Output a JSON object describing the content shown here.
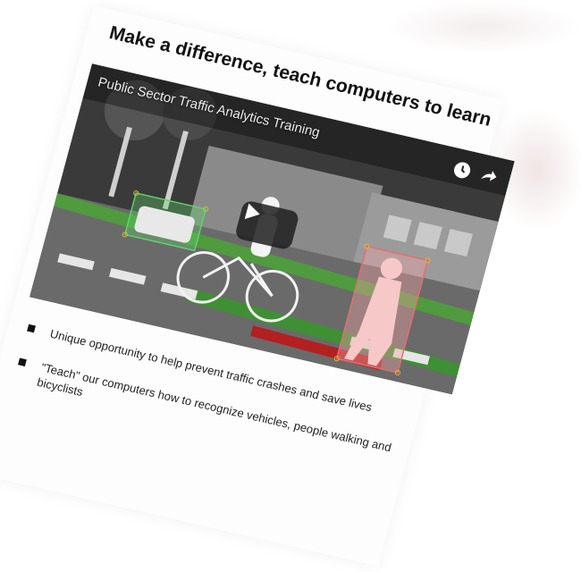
{
  "slide": {
    "title": "Make a difference, teach computers to learn"
  },
  "video": {
    "title": "Public Sector Traffic Analytics Training",
    "controls": {
      "watch_later_icon": "clock-icon",
      "share_icon": "share-arrow-icon",
      "play_icon": "play-icon"
    },
    "annotation_colors": {
      "vehicle": "#5fd36a",
      "pedestrian": "#f2a3a3",
      "handles": "#e8b830"
    }
  },
  "bullets": [
    {
      "text": "Unique opportunity to help prevent traffic crashes and save lives"
    },
    {
      "text": "\"Teach\" our computers how to recognize vehicles, people walking and bicyclists"
    }
  ]
}
